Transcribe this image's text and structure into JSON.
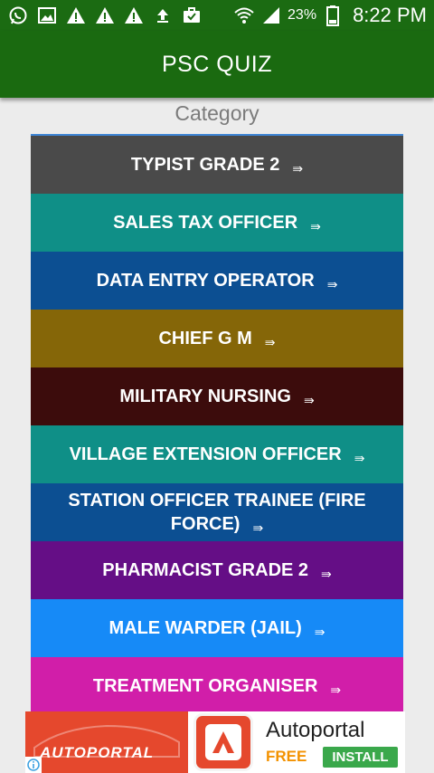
{
  "status_bar": {
    "battery_percent": "23%",
    "time": "8:22 PM",
    "left_icons": [
      "whatsapp-icon",
      "image-icon",
      "warning-icon",
      "warning-icon",
      "warning-icon",
      "upload-icon",
      "briefcase-icon"
    ],
    "right_icons": [
      "wifi-icon",
      "signal-icon",
      "battery-icon"
    ]
  },
  "app_bar": {
    "title": "PSC QUIZ",
    "color": "#1a6a10"
  },
  "category_heading": "Category",
  "categories": [
    {
      "label": "TYPIST GRADE 2",
      "arrow": "⇛",
      "color": "#4a4a4a"
    },
    {
      "label": "SALES TAX OFFICER",
      "arrow": "⇛",
      "color": "#0f8f87"
    },
    {
      "label": "DATA ENTRY OPERATOR",
      "arrow": "⇛",
      "color": "#0c4f92"
    },
    {
      "label": "CHIEF G M",
      "arrow": "⇛",
      "color": "#856608"
    },
    {
      "label": "MILITARY NURSING",
      "arrow": "⇛",
      "color": "#3c0c0c"
    },
    {
      "label": "VILLAGE EXTENSION OFFICER",
      "arrow": "⇛",
      "color": "#0f8f87"
    },
    {
      "label": "STATION OFFICER TRAINEE (FIRE FORCE)",
      "arrow": "⇛",
      "color": "#0c4f92"
    },
    {
      "label": "PHARMACIST GRADE 2",
      "arrow": "⇛",
      "color": "#650e86"
    },
    {
      "label": "MALE WARDER (JAIL)",
      "arrow": "⇛",
      "color": "#168af7"
    },
    {
      "label": "TREATMENT ORGANISER",
      "arrow": "⇛",
      "color": "#d11ea9"
    }
  ],
  "ad": {
    "image_text": "AUTOPORTAL",
    "app_name": "Autoportal",
    "price": "FREE",
    "install_label": "INSTALL"
  }
}
